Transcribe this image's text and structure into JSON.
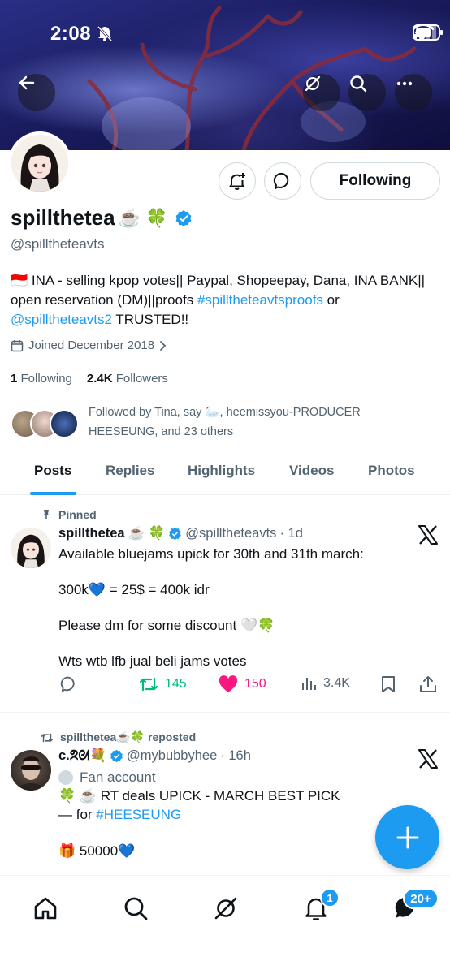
{
  "status_bar": {
    "time": "2:08"
  },
  "profile": {
    "display_name": "spillthetea",
    "name_emojis": "☕️ 🍀",
    "handle": "@spilltheteavts",
    "bio_prefix": "🇮🇩 INA - selling kpop votes|| Paypal, Shopeepay, Dana, INA BANK|| open reservation (DM)||proofs ",
    "bio_link_tag": "#spilltheteavtsproofs",
    "bio_or": " or ",
    "bio_link_handle": "@spilltheteavts2",
    "bio_suffix": " TRUSTED!!",
    "joined": "Joined December 2018",
    "following_count": "1",
    "following_label": "Following",
    "followers_count": "2.4K",
    "followers_label": "Followers",
    "followed_by": "Followed by Tina, say 🦢, heemissyou-PRODUCER HEESEUNG, and 23 others",
    "following_button": "Following"
  },
  "tabs": [
    {
      "label": "Posts"
    },
    {
      "label": "Replies"
    },
    {
      "label": "Highlights"
    },
    {
      "label": "Videos"
    },
    {
      "label": "Photos"
    }
  ],
  "posts": [
    {
      "pinned_label": "Pinned",
      "name": "spillthetea",
      "name_emojis": "☕️ 🍀",
      "handle": "@spilltheteavts",
      "time": "· 1d",
      "lines": [
        "Available bluejams upick for 30th and 31th march:",
        "300k💙 = 25$ = 400k idr",
        "Please dm for some discount 🤍🍀",
        "Wts wtb lfb jual beli jams votes"
      ],
      "retweets": "145",
      "likes": "150",
      "views": "3.4K"
    },
    {
      "repost_label": "spillthetea☕️🍀 reposted",
      "name": "c.ᘝᘛ💐",
      "handle": "@mybubbyhee",
      "time": "· 16h",
      "fan_label": "Fan account",
      "lines": [
        "🍀 ☕️ RT deals  UPICK - MARCH BEST PICK",
        "— for ",
        "🎁 50000💙"
      ],
      "hashtag": "#HEESEUNG"
    }
  ],
  "bottom_nav": {
    "notifications_badge": "1",
    "messages_badge": "20+"
  },
  "colors": {
    "accent": "#1d9bf0",
    "like": "#f91880",
    "retweet": "#00ba7c",
    "text_secondary": "#536471"
  }
}
